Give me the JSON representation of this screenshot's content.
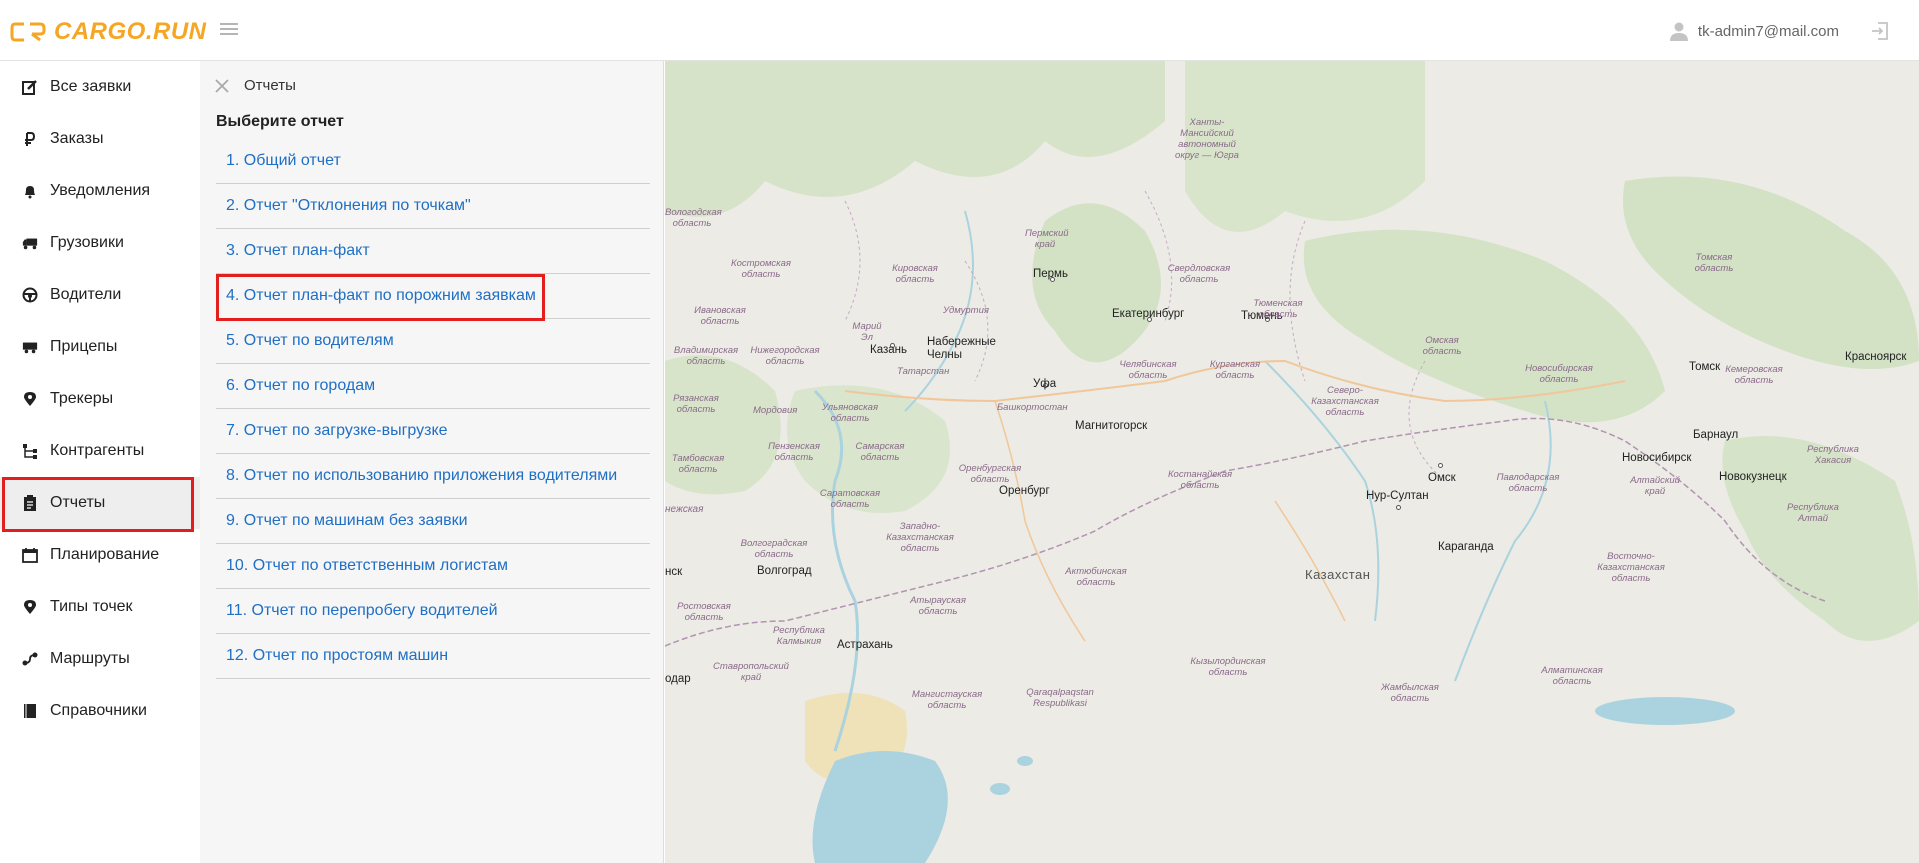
{
  "header": {
    "logo_text": "CARGO.RUN",
    "user_email": "tk-admin7@mail.com",
    "accent_color": "#f5a623"
  },
  "sidebar": {
    "items": [
      {
        "label": "Все заявки",
        "icon": "edit-icon"
      },
      {
        "label": "Заказы",
        "icon": "ruble-icon"
      },
      {
        "label": "Уведомления",
        "icon": "bell-icon"
      },
      {
        "label": "Грузовики",
        "icon": "truck-icon"
      },
      {
        "label": "Водители",
        "icon": "steering-wheel-icon"
      },
      {
        "label": "Прицепы",
        "icon": "trailer-icon"
      },
      {
        "label": "Трекеры",
        "icon": "map-pin-icon"
      },
      {
        "label": "Контрагенты",
        "icon": "hierarchy-icon"
      },
      {
        "label": "Отчеты",
        "icon": "clipboard-icon"
      },
      {
        "label": "Планирование",
        "icon": "calendar-icon"
      },
      {
        "label": "Типы точек",
        "icon": "map-pin-icon"
      },
      {
        "label": "Маршруты",
        "icon": "route-icon"
      },
      {
        "label": "Справочники",
        "icon": "book-icon"
      }
    ],
    "active_index": 8
  },
  "reports": {
    "title": "Отчеты",
    "select_label": "Выберите отчет",
    "items": [
      "1. Общий отчет",
      "2. Отчет \"Отклонения по точкам\"",
      "3. Отчет план-факт",
      "4. Отчет план-факт по порожним заявкам",
      "5. Отчет по водителям",
      "6. Отчет по городам",
      "7. Отчет по загрузке-выгрузке",
      "8. Отчет по использованию приложения водителями",
      "9. Отчет по машинам без заявки",
      "10. Отчет по ответственным логистам",
      "11. Отчет по перепробегу водителей",
      "12. Отчет по простоям машин"
    ],
    "highlighted_index": 3,
    "link_color": "#1f6fc5"
  },
  "map": {
    "cities": [
      "Пермь",
      "Екатеринбург",
      "Тюмень",
      "Казань",
      "Набережные Челны",
      "Уфа",
      "Магнитогорск",
      "Оренбург",
      "Омск",
      "Нур-Султан",
      "Караганда",
      "Новосибирск",
      "Томск",
      "Барнаул",
      "Новокузнецк",
      "Красноярск",
      "Волгоград",
      "Астрахань"
    ],
    "regions": [
      "Ханты-Мансийский автономный округ — Югра",
      "Пермский край",
      "Свердловская область",
      "Кировская область",
      "Костромская область",
      "Ивановская область",
      "Удмуртия",
      "Марий Эл",
      "Тюменская область",
      "Томская область",
      "Нижегородская область",
      "Владимирская область",
      "Татарстан",
      "Челябинская область",
      "Курганская область",
      "Омская область",
      "Новосибирская область",
      "Кемеровская область",
      "Рязанская область",
      "Мордовия",
      "Ульяновская область",
      "Башкортостан",
      "Северо-Казахстанская область",
      "Пензенская область",
      "Самарская область",
      "Тамбовская область",
      "Республика Хакасия",
      "Оренбургская область",
      "Костанайская область",
      "Алтайский край",
      "Саратовская область",
      "Павлодарская область",
      "Республика Алтай",
      "Западно-Казахстанская область",
      "Волгоградская область",
      "Актюбинская область",
      "Казахстан",
      "Восточно-Казахстанская область",
      "Ростовская область",
      "Атырауская область",
      "Республика Калмыкия",
      "Ставропольский край",
      "Мангистауская область",
      "Qaraqalpaqstan Respublikasi",
      "Кызылординская область",
      "Жамбылская область",
      "Алматинская область",
      "Вологодская область"
    ],
    "partial_labels": [
      "нежская",
      "нск",
      "одар"
    ]
  }
}
